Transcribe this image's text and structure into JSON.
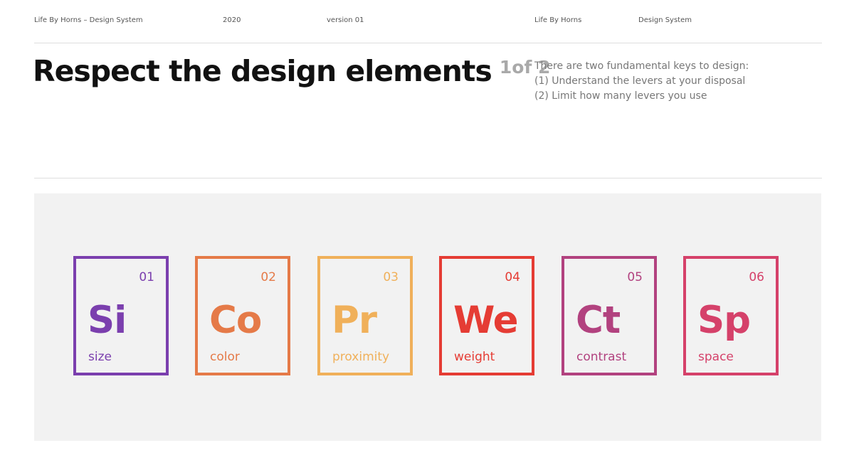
{
  "header": {
    "brand_system": "Life By Horns – Design System",
    "year": "2020",
    "version": "version 01",
    "brand": "Life By Horns",
    "section": "Design System"
  },
  "title": {
    "main": "Respect the design elements",
    "count": "1of 2"
  },
  "intro": {
    "lead": "There are two fundamental keys to design:",
    "points": [
      "(1)  Understand the levers at your disposal",
      "(2)  Limit how many levers you use"
    ]
  },
  "elements": [
    {
      "number": "01",
      "symbol": "Si",
      "name": "size",
      "color": "#7b3fae"
    },
    {
      "number": "02",
      "symbol": "Co",
      "name": "color",
      "color": "#e57a48"
    },
    {
      "number": "03",
      "symbol": "Pr",
      "name": "proximity",
      "color": "#f0b05a"
    },
    {
      "number": "04",
      "symbol": "We",
      "name": "weight",
      "color": "#e53c34"
    },
    {
      "number": "05",
      "symbol": "Ct",
      "name": "contrast",
      "color": "#b2427f"
    },
    {
      "number": "06",
      "symbol": "Sp",
      "name": "space",
      "color": "#d5416a"
    }
  ],
  "colors": {
    "panel_background": "#f2f2f2",
    "title_text": "#111111",
    "muted_text": "#777777",
    "divider": "#dedede"
  }
}
